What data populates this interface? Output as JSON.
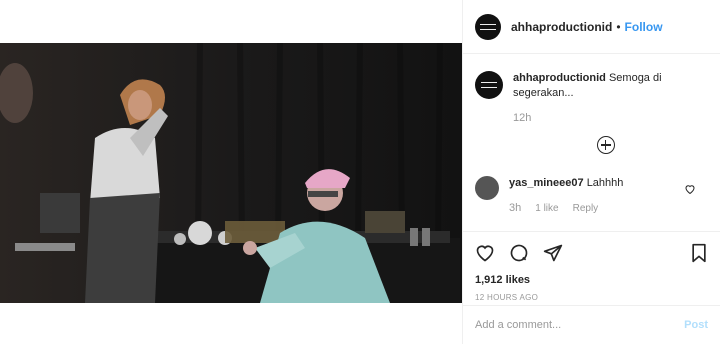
{
  "post": {
    "author": "ahhaproductionid",
    "separator": "•",
    "follow_label": "Follow",
    "caption": {
      "username": "ahhaproductionid",
      "text": "Semoga di segerakan...",
      "time": "12h"
    },
    "comments": [
      {
        "username": "yas_mineee07",
        "text": "Lahhhh",
        "time": "3h",
        "likes": "1 like",
        "reply_label": "Reply"
      }
    ],
    "likes": "1,912 likes",
    "time_ago": "12 HOURS AGO",
    "add_comment_placeholder": "Add a comment...",
    "post_label": "Post"
  },
  "colors": {
    "link_blue": "#3897f0",
    "post_disabled": "#b2dffc",
    "meta_gray": "#999999",
    "border": "#efefef"
  },
  "icons": [
    "heart-icon",
    "comment-icon",
    "share-icon",
    "bookmark-icon",
    "load-more-icon",
    "comment-like-icon"
  ]
}
